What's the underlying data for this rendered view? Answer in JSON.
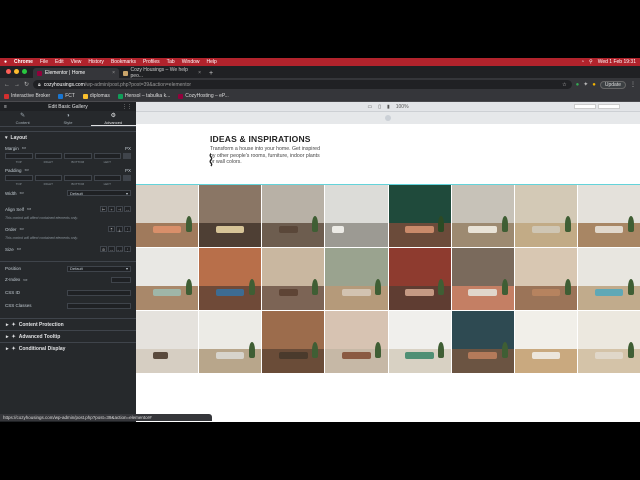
{
  "menubar": {
    "items": [
      "Chrome",
      "File",
      "Edit",
      "View",
      "History",
      "Bookmarks",
      "Profiles",
      "Tab",
      "Window",
      "Help"
    ],
    "clock": "Wed 1 Feb 19:31"
  },
  "tabs": [
    {
      "title": "Elementor | Home",
      "active": true
    },
    {
      "title": "Cozy Housings – We help peo...",
      "active": false
    }
  ],
  "address": {
    "host": "cozyhousings.com",
    "path": "/wp-admin/post.php?post=39&action=elementor",
    "update_label": "Update"
  },
  "bookmarks": [
    "Interactive Broker",
    "FCT",
    "diplomas",
    "Hensol – tabulka k...",
    "CozyHosting – eP..."
  ],
  "panel": {
    "title": "Edit Basic Gallery",
    "tabs": [
      {
        "label": "Content",
        "icon": "pencil-icon"
      },
      {
        "label": "Style",
        "icon": "contrast-icon"
      },
      {
        "label": "Advanced",
        "icon": "gear-icon"
      }
    ],
    "section": "Layout",
    "margin_label": "Margin",
    "padding_label": "Padding",
    "unit": "PX",
    "sides": [
      "TOP",
      "RIGHT",
      "BOTTOM",
      "LEFT"
    ],
    "width_label": "Width",
    "width_value": "Default",
    "align_self_label": "Align Self",
    "align_note": "This control will affect contained elements only.",
    "order_label": "Order",
    "order_note": "This control will affect contained elements only.",
    "size_label": "Size",
    "position_label": "Position",
    "position_value": "Default",
    "zindex_label": "Z-Index",
    "cssid_label": "CSS ID",
    "cssclasses_label": "CSS Classes",
    "accordions": [
      "Content Protection",
      "Advanced Tooltip",
      "Conditional Display"
    ]
  },
  "canvas": {
    "zoom": "100%",
    "heading": "IDEAS & INSPIRATIONS",
    "description": "Transform a house into your home. Get inspired by other people's rooms, furniture, indoor plants or wall colors."
  },
  "status_url": "https://cozyhousings.com/wp-admin/post.php?post=39&action=elementor#"
}
